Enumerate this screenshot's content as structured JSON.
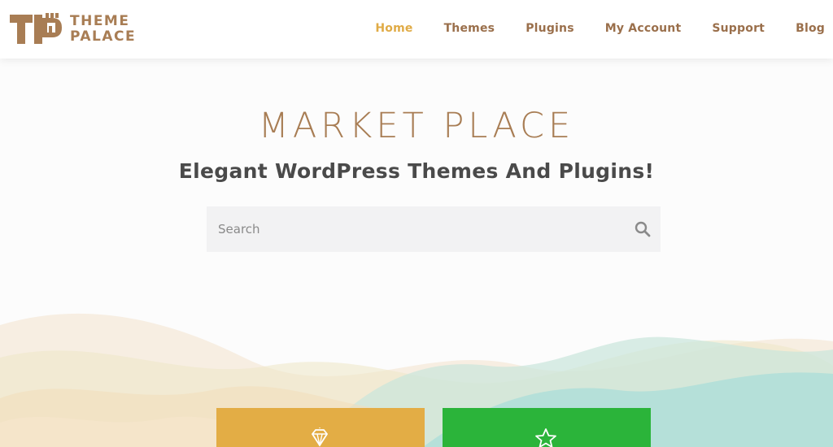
{
  "brand": {
    "line1": "THEME",
    "line2": "PALACE",
    "color": "#a87d54"
  },
  "nav": {
    "items": [
      {
        "label": "Home",
        "active": true
      },
      {
        "label": "Themes"
      },
      {
        "label": "Plugins"
      },
      {
        "label": "My Account"
      },
      {
        "label": "Support"
      },
      {
        "label": "Blog"
      }
    ],
    "active_color": "#e0ab46"
  },
  "hero": {
    "title": "MARKET PLACE",
    "subtitle": "Elegant WordPress Themes And Plugins!"
  },
  "search": {
    "placeholder": "Search",
    "icon": "search-icon"
  },
  "cards": [
    {
      "color": "#e3ad45",
      "icon": "diamond-icon"
    },
    {
      "color": "#2bb43a",
      "icon": "star-icon"
    }
  ]
}
